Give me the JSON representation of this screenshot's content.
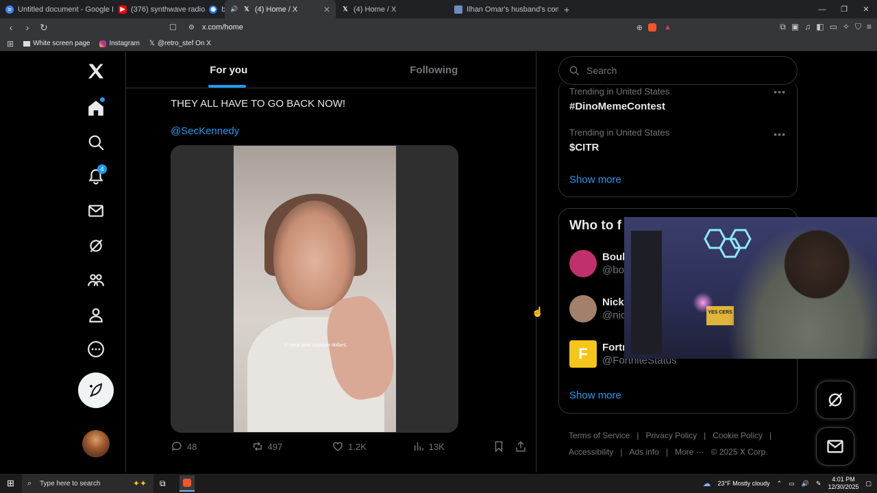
{
  "browser": {
    "tabs": [
      {
        "title": "Untitled document - Google Docs",
        "icon": "docs-icon"
      },
      {
        "title": "(376) synthwave radio",
        "icon": "youtube-icon"
      },
      {
        "title": "beats",
        "icon": "audio-icon"
      },
      {
        "title": "(4) Home / X",
        "icon": "x-icon"
      },
      {
        "title": "(4) Home / X",
        "icon": "x-icon"
      },
      {
        "title": "Ilhan Omar's husband's companies s",
        "icon": "page-icon"
      }
    ],
    "url": "x.com/home",
    "bookmarks": [
      {
        "label": "White screen page"
      },
      {
        "label": "Instagram"
      },
      {
        "label": "@retro_stef On X"
      }
    ]
  },
  "feed": {
    "tabs": [
      "For you",
      "Following"
    ],
    "active_tab": "For you",
    "post": {
      "text": "THEY ALL HAVE TO GO BACK NOW!",
      "mention": "@SecKennedy",
      "video_caption": "to steal your taxpayer dollars.",
      "replies": "48",
      "reposts": "497",
      "likes": "1.2K",
      "views": "13K"
    }
  },
  "sidebar": {
    "notifications_badge": "4"
  },
  "right": {
    "search_placeholder": "Search",
    "trends": [
      {
        "context": "Trending in United States",
        "name": "#DinoMemeContest"
      },
      {
        "context": "Trending in United States",
        "name": "$CITR"
      }
    ],
    "show_more": "Show more",
    "who_title": "Who to f",
    "who": [
      {
        "name": "Boub",
        "handle": "@bo",
        "color": "#c2306b"
      },
      {
        "name": "Nick",
        "handle": "@nic",
        "color": "#a3806a"
      },
      {
        "name": "Fortr",
        "handle": "@FortniteStatus",
        "color": "#f5c518"
      }
    ],
    "footer": [
      "Terms of Service",
      "|",
      "Privacy Policy",
      "|",
      "Cookie Policy",
      "|",
      "Accessibility",
      "|",
      "Ads info",
      "|",
      "More ···",
      "© 2025 X Corp."
    ]
  },
  "taskbar": {
    "search": "Type here to search",
    "weather": "23°F  Mostly cloudy",
    "time": "4:01 PM",
    "date": "12/30/2025"
  },
  "webcam": {
    "sign_text": "YES CERS"
  }
}
